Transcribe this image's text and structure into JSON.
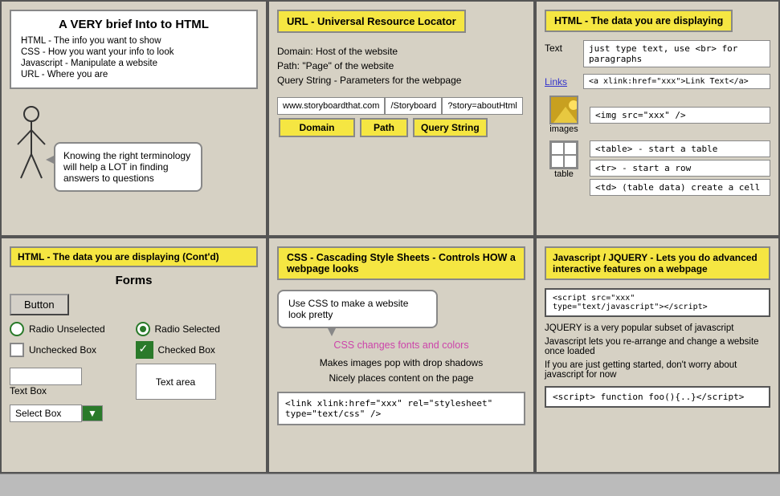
{
  "panel1": {
    "title": "A VERY brief Into to HTML",
    "lines": [
      "HTML - The info you want to show",
      "CSS - How you want your info to look",
      "Javascript - Manipulate a website",
      "URL - Where you are"
    ],
    "bubble_text": "Knowing the right terminology will help a LOT in finding answers to questions"
  },
  "panel2": {
    "header": "URL - Universal Resource Locator",
    "url_lines": [
      "Domain: Host of the website",
      "Path: \"Page\" of the website",
      "Query String - Parameters for the webpage"
    ],
    "domain_val": "www.storyboardthat.com",
    "path_val": "/Storyboard",
    "query_val": "?story=aboutHtml",
    "label_domain": "Domain",
    "label_path": "Path",
    "label_query": "Query String"
  },
  "panel3": {
    "header": "HTML - The data you are displaying",
    "text_label": "Text",
    "text_code": "just type text, use <br> for paragraphs",
    "links_label": "Links",
    "links_code": "<a xlink:href=\"xxx\">Link Text</a>",
    "images_label": "images",
    "images_code": "<img src=\"xxx\" />",
    "table_label": "table",
    "table_code1": "<table> - start a table",
    "table_code2": "<tr> - start a row",
    "table_code3": "<td> (table data) create a cell"
  },
  "panel4": {
    "header": "HTML - The data you are displaying (Cont'd)",
    "forms_title": "Forms",
    "button_label": "Button",
    "radio_unselected": "Radio Unselected",
    "radio_selected": "Radio Selected",
    "unchecked_box": "Unchecked Box",
    "checked_box": "Checked Box",
    "text_box": "Text Box",
    "text_area": "Text area",
    "select_box": "Select Box"
  },
  "panel5": {
    "header": "CSS - Cascading Style Sheets - Controls HOW a webpage looks",
    "bubble": "Use CSS to make a website look pretty",
    "pink_text": "CSS changes fonts and colors",
    "bullet1": "Makes images pop with drop shadows",
    "bullet2": "Nicely places content on the page",
    "code": "<link xlink:href=\"xxx\" rel=\"stylesheet\"\ntype=\"text/css\" />"
  },
  "panel6": {
    "header": "Javascript / JQUERY - Lets you do advanced interactive features on a webpage",
    "code1_line1": "<script src=\"xxx\"",
    "code1_line2": "type=\"text/javascript\"></script>",
    "text1": "JQUERY is a very popular subset of javascript",
    "text2": "Javascript lets you re-arrange and change a website once loaded",
    "text3": "If you are just getting started, don't worry about javascript for now",
    "code2": "<script> function foo(){..}</script>"
  }
}
